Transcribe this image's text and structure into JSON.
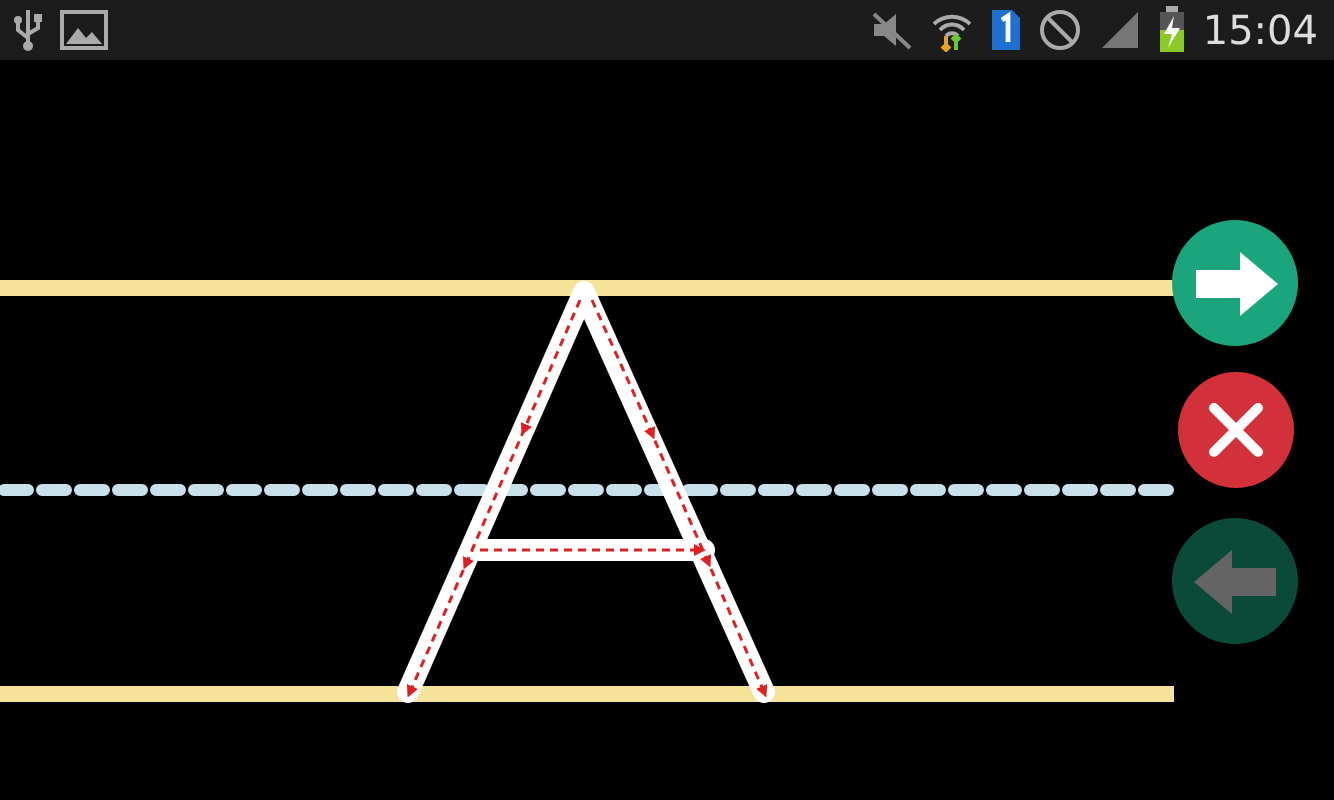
{
  "status_bar": {
    "time": "15:04"
  },
  "buttons": [
    {
      "kind": "next",
      "disabled": false
    },
    {
      "kind": "clear",
      "disabled": false
    },
    {
      "kind": "back",
      "disabled": true
    }
  ]
}
